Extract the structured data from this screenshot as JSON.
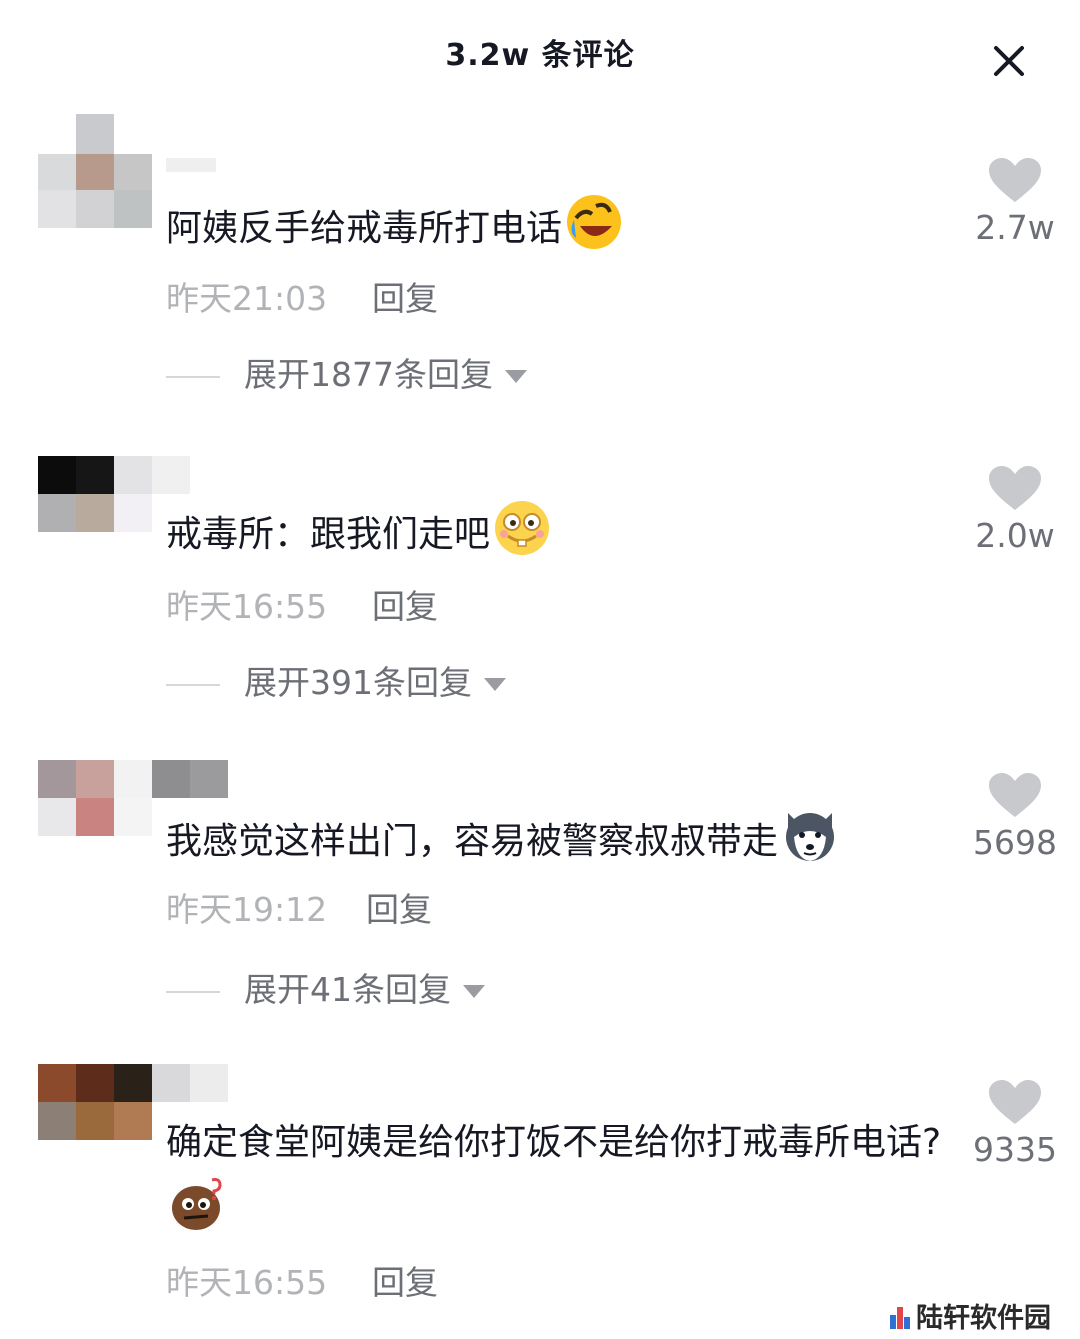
{
  "header": {
    "title": "3.2w 条评论"
  },
  "colors": {
    "text": "#161823",
    "muted": "#b2b3b7",
    "secondary": "#6d6f77",
    "heart": "#c8c9cc"
  },
  "comments": [
    {
      "text": "阿姨反手给戒毒所打电话",
      "emoji": "rofl-emoji",
      "time": "昨天21:03",
      "reply_label": "回复",
      "expand_label": "展开1877条回复",
      "likes": "2.7w"
    },
    {
      "text": "戒毒所：跟我们走吧",
      "emoji": "silly-face-emoji",
      "time": "昨天16:55",
      "reply_label": "回复",
      "expand_label": "展开391条回复",
      "likes": "2.0w"
    },
    {
      "text": "我感觉这样出门，容易被警察叔叔带走",
      "emoji": "husky-dog-emoji",
      "time": "昨天19:12",
      "reply_label": "回复",
      "expand_label": "展开41条回复",
      "likes": "5698"
    },
    {
      "text": "确定食堂阿姨是给你打饭不是给你打戒毒所电话?",
      "emoji": "confused-bean-emoji",
      "time": "昨天16:55",
      "reply_label": "回复",
      "likes": "9335"
    }
  ],
  "watermark": {
    "text": "陆轩软件园"
  }
}
